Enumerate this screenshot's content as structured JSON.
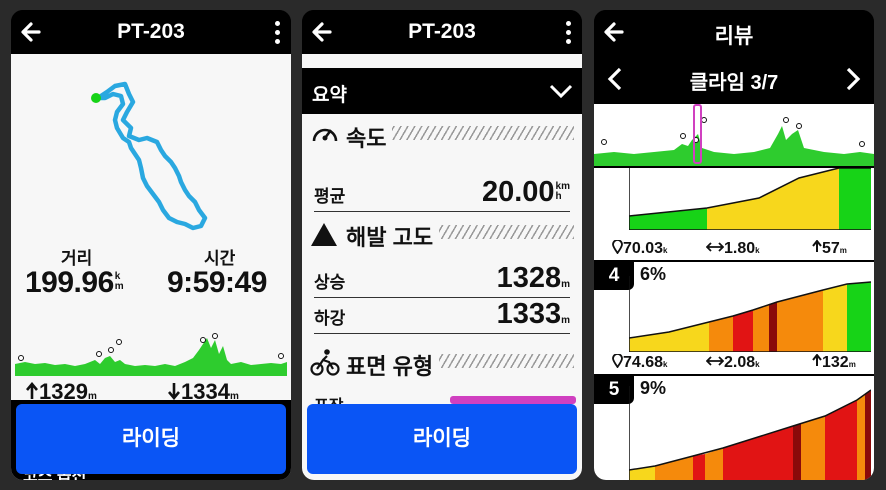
{
  "device1": {
    "title": "PT-203",
    "distance_label": "거리",
    "distance_value": "199.96",
    "distance_unit_top": "k",
    "distance_unit_bottom": "m",
    "time_label": "시간",
    "time_value": "9:59:49",
    "ascent": "1329",
    "ascent_unit": "m",
    "descent": "1334",
    "descent_unit": "m",
    "ride_label": "라이딩",
    "cut_text": "코스 옵션"
  },
  "device2": {
    "title": "PT-203",
    "summary_label": "요약",
    "speed_section": "속도",
    "avg_label": "평균",
    "avg_value": "20.00",
    "avg_unit_top": "km",
    "avg_unit_bottom": "h",
    "elev_section": "해발 고도",
    "ascent_label": "상승",
    "ascent_value": "1328",
    "ascent_unit": "m",
    "descent_label": "하강",
    "descent_value": "1333",
    "descent_unit": "m",
    "surface_section": "표면 유형",
    "paved_label": "포장",
    "ride_label": "라이딩"
  },
  "device3": {
    "title": "리뷰",
    "climb_nav": "클라임 3/7",
    "climbs": [
      {
        "num": "",
        "grade": "",
        "elev": "70.03",
        "dist": "1.80",
        "gain": "57"
      },
      {
        "num": "4",
        "grade": "6%",
        "elev": "74.68",
        "dist": "2.08",
        "gain": "132"
      },
      {
        "num": "5",
        "grade": "9%",
        "elev": "",
        "dist": "",
        "gain": ""
      }
    ],
    "unit_km_top": "k",
    "unit_km_bottom": "m",
    "unit_m": "m"
  },
  "colors": {
    "accent_blue": "#0a55f5",
    "route_blue": "#2aa8e0",
    "profile_green": "#2ecc2e",
    "grade_green": "#17d317",
    "grade_yellow": "#f7d71c",
    "grade_orange": "#f58a0c",
    "grade_red": "#e11414",
    "grade_darkred": "#8a0a0a",
    "highlight_magenta": "#d040c0"
  },
  "icons": [
    "back-arrow-icon",
    "more-vert-icon",
    "chevron-down-icon",
    "speedometer-icon",
    "mountain-icon",
    "cyclist-icon",
    "chevron-left-icon",
    "chevron-right-icon",
    "location-pin-icon",
    "horizontal-arrows-icon",
    "up-arrow-icon",
    "down-arrow-icon"
  ]
}
